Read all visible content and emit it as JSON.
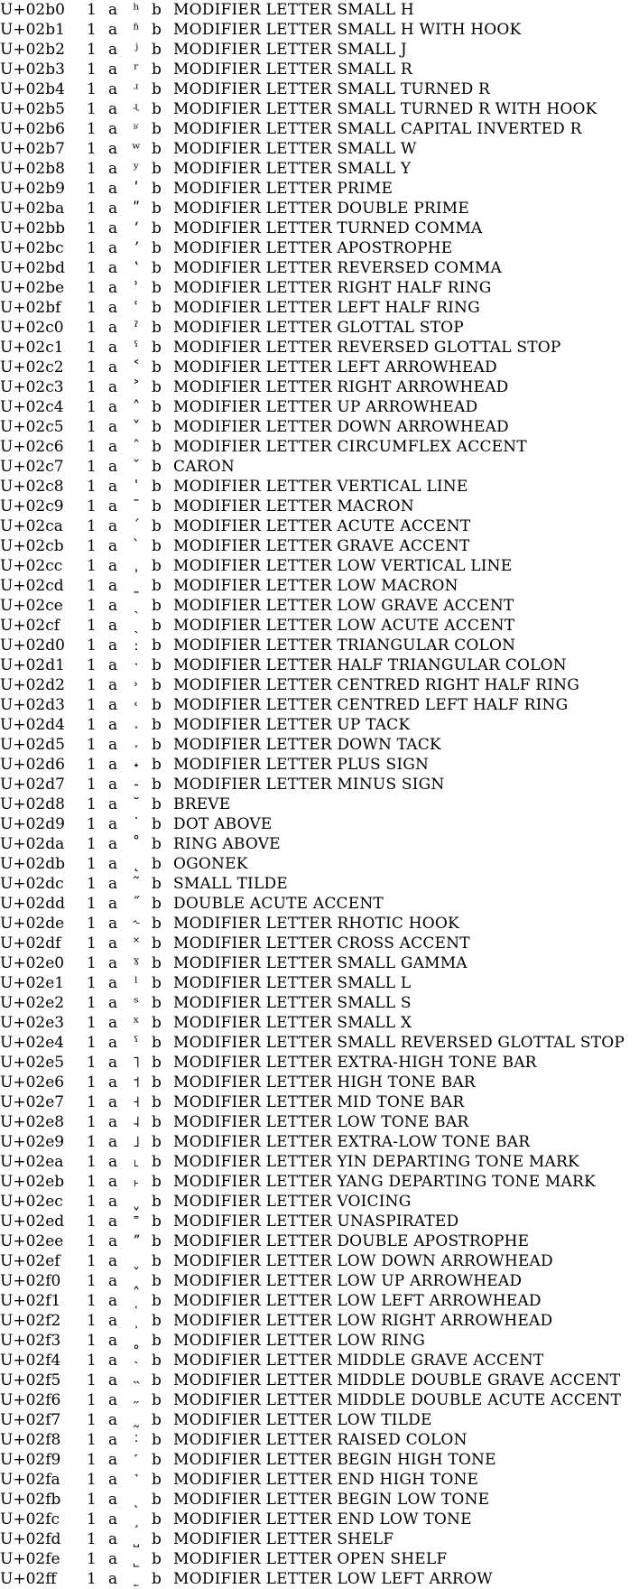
{
  "rows": [
    {
      "code": "U+02b0",
      "n": "1",
      "a": "a",
      "glyph": "ʰ",
      "b": "b",
      "name": "MODIFIER LETTER SMALL H"
    },
    {
      "code": "U+02b1",
      "n": "1",
      "a": "a",
      "glyph": "ʱ",
      "b": "b",
      "name": "MODIFIER LETTER SMALL H WITH HOOK"
    },
    {
      "code": "U+02b2",
      "n": "1",
      "a": "a",
      "glyph": "ʲ",
      "b": "b",
      "name": "MODIFIER LETTER SMALL J"
    },
    {
      "code": "U+02b3",
      "n": "1",
      "a": "a",
      "glyph": "ʳ",
      "b": "b",
      "name": "MODIFIER LETTER SMALL R"
    },
    {
      "code": "U+02b4",
      "n": "1",
      "a": "a",
      "glyph": "ʴ",
      "b": "b",
      "name": "MODIFIER LETTER SMALL TURNED R"
    },
    {
      "code": "U+02b5",
      "n": "1",
      "a": "a",
      "glyph": "ʵ",
      "b": "b",
      "name": "MODIFIER LETTER SMALL TURNED R WITH HOOK"
    },
    {
      "code": "U+02b6",
      "n": "1",
      "a": "a",
      "glyph": "ʶ",
      "b": "b",
      "name": "MODIFIER LETTER SMALL CAPITAL INVERTED R"
    },
    {
      "code": "U+02b7",
      "n": "1",
      "a": "a",
      "glyph": "ʷ",
      "b": "b",
      "name": "MODIFIER LETTER SMALL W"
    },
    {
      "code": "U+02b8",
      "n": "1",
      "a": "a",
      "glyph": "ʸ",
      "b": "b",
      "name": "MODIFIER LETTER SMALL Y"
    },
    {
      "code": "U+02b9",
      "n": "1",
      "a": "a",
      "glyph": "ʹ",
      "b": "b",
      "name": "MODIFIER LETTER PRIME"
    },
    {
      "code": "U+02ba",
      "n": "1",
      "a": "a",
      "glyph": "ʺ",
      "b": "b",
      "name": "MODIFIER LETTER DOUBLE PRIME"
    },
    {
      "code": "U+02bb",
      "n": "1",
      "a": "a",
      "glyph": "ʻ",
      "b": "b",
      "name": "MODIFIER LETTER TURNED COMMA"
    },
    {
      "code": "U+02bc",
      "n": "1",
      "a": "a",
      "glyph": "ʼ",
      "b": "b",
      "name": "MODIFIER LETTER APOSTROPHE"
    },
    {
      "code": "U+02bd",
      "n": "1",
      "a": "a",
      "glyph": "ʽ",
      "b": "b",
      "name": "MODIFIER LETTER REVERSED COMMA"
    },
    {
      "code": "U+02be",
      "n": "1",
      "a": "a",
      "glyph": "ʾ",
      "b": "b",
      "name": "MODIFIER LETTER RIGHT HALF RING"
    },
    {
      "code": "U+02bf",
      "n": "1",
      "a": "a",
      "glyph": "ʿ",
      "b": "b",
      "name": "MODIFIER LETTER LEFT HALF RING"
    },
    {
      "code": "U+02c0",
      "n": "1",
      "a": "a",
      "glyph": "ˀ",
      "b": "b",
      "name": "MODIFIER LETTER GLOTTAL STOP"
    },
    {
      "code": "U+02c1",
      "n": "1",
      "a": "a",
      "glyph": "ˁ",
      "b": "b",
      "name": "MODIFIER LETTER REVERSED GLOTTAL STOP"
    },
    {
      "code": "U+02c2",
      "n": "1",
      "a": "a",
      "glyph": "˂",
      "b": "b",
      "name": "MODIFIER LETTER LEFT ARROWHEAD"
    },
    {
      "code": "U+02c3",
      "n": "1",
      "a": "a",
      "glyph": "˃",
      "b": "b",
      "name": "MODIFIER LETTER RIGHT ARROWHEAD"
    },
    {
      "code": "U+02c4",
      "n": "1",
      "a": "a",
      "glyph": "˄",
      "b": "b",
      "name": "MODIFIER LETTER UP ARROWHEAD"
    },
    {
      "code": "U+02c5",
      "n": "1",
      "a": "a",
      "glyph": "˅",
      "b": "b",
      "name": "MODIFIER LETTER DOWN ARROWHEAD"
    },
    {
      "code": "U+02c6",
      "n": "1",
      "a": "a",
      "glyph": "ˆ",
      "b": "b",
      "name": "MODIFIER LETTER CIRCUMFLEX ACCENT"
    },
    {
      "code": "U+02c7",
      "n": "1",
      "a": "a",
      "glyph": "ˇ",
      "b": "b",
      "name": "CARON"
    },
    {
      "code": "U+02c8",
      "n": "1",
      "a": "a",
      "glyph": "ˈ",
      "b": "b",
      "name": "MODIFIER LETTER VERTICAL LINE"
    },
    {
      "code": "U+02c9",
      "n": "1",
      "a": "a",
      "glyph": "ˉ",
      "b": "b",
      "name": "MODIFIER LETTER MACRON"
    },
    {
      "code": "U+02ca",
      "n": "1",
      "a": "a",
      "glyph": "ˊ",
      "b": "b",
      "name": "MODIFIER LETTER ACUTE ACCENT"
    },
    {
      "code": "U+02cb",
      "n": "1",
      "a": "a",
      "glyph": "ˋ",
      "b": "b",
      "name": "MODIFIER LETTER GRAVE ACCENT"
    },
    {
      "code": "U+02cc",
      "n": "1",
      "a": "a",
      "glyph": "ˌ",
      "b": "b",
      "name": "MODIFIER LETTER LOW VERTICAL LINE"
    },
    {
      "code": "U+02cd",
      "n": "1",
      "a": "a",
      "glyph": "ˍ",
      "b": "b",
      "name": "MODIFIER LETTER LOW MACRON"
    },
    {
      "code": "U+02ce",
      "n": "1",
      "a": "a",
      "glyph": "ˎ",
      "b": "b",
      "name": "MODIFIER LETTER LOW GRAVE ACCENT"
    },
    {
      "code": "U+02cf",
      "n": "1",
      "a": "a",
      "glyph": "ˏ",
      "b": "b",
      "name": "MODIFIER LETTER LOW ACUTE ACCENT"
    },
    {
      "code": "U+02d0",
      "n": "1",
      "a": "a",
      "glyph": "ː",
      "b": "b",
      "name": "MODIFIER LETTER TRIANGULAR COLON"
    },
    {
      "code": "U+02d1",
      "n": "1",
      "a": "a",
      "glyph": "ˑ",
      "b": "b",
      "name": "MODIFIER LETTER HALF TRIANGULAR COLON"
    },
    {
      "code": "U+02d2",
      "n": "1",
      "a": "a",
      "glyph": "˒",
      "b": "b",
      "name": "MODIFIER LETTER CENTRED RIGHT HALF RING"
    },
    {
      "code": "U+02d3",
      "n": "1",
      "a": "a",
      "glyph": "˓",
      "b": "b",
      "name": "MODIFIER LETTER CENTRED LEFT HALF RING"
    },
    {
      "code": "U+02d4",
      "n": "1",
      "a": "a",
      "glyph": "˔",
      "b": "b",
      "name": "MODIFIER LETTER UP TACK"
    },
    {
      "code": "U+02d5",
      "n": "1",
      "a": "a",
      "glyph": "˕",
      "b": "b",
      "name": "MODIFIER LETTER DOWN TACK"
    },
    {
      "code": "U+02d6",
      "n": "1",
      "a": "a",
      "glyph": "˖",
      "b": "b",
      "name": "MODIFIER LETTER PLUS SIGN"
    },
    {
      "code": "U+02d7",
      "n": "1",
      "a": "a",
      "glyph": "˗",
      "b": "b",
      "name": "MODIFIER LETTER MINUS SIGN"
    },
    {
      "code": "U+02d8",
      "n": "1",
      "a": "a",
      "glyph": "˘",
      "b": "b",
      "name": "BREVE"
    },
    {
      "code": "U+02d9",
      "n": "1",
      "a": "a",
      "glyph": "˙",
      "b": "b",
      "name": "DOT ABOVE"
    },
    {
      "code": "U+02da",
      "n": "1",
      "a": "a",
      "glyph": "˚",
      "b": "b",
      "name": "RING ABOVE"
    },
    {
      "code": "U+02db",
      "n": "1",
      "a": "a",
      "glyph": "˛",
      "b": "b",
      "name": "OGONEK"
    },
    {
      "code": "U+02dc",
      "n": "1",
      "a": "a",
      "glyph": "˜",
      "b": "b",
      "name": "SMALL TILDE"
    },
    {
      "code": "U+02dd",
      "n": "1",
      "a": "a",
      "glyph": "˝",
      "b": "b",
      "name": "DOUBLE ACUTE ACCENT"
    },
    {
      "code": "U+02de",
      "n": "1",
      "a": "a",
      "glyph": "˞",
      "b": "b",
      "name": "MODIFIER LETTER RHOTIC HOOK"
    },
    {
      "code": "U+02df",
      "n": "1",
      "a": "a",
      "glyph": "˟",
      "b": "b",
      "name": "MODIFIER LETTER CROSS ACCENT"
    },
    {
      "code": "U+02e0",
      "n": "1",
      "a": "a",
      "glyph": "ˠ",
      "b": "b",
      "name": "MODIFIER LETTER SMALL GAMMA"
    },
    {
      "code": "U+02e1",
      "n": "1",
      "a": "a",
      "glyph": "ˡ",
      "b": "b",
      "name": "MODIFIER LETTER SMALL L"
    },
    {
      "code": "U+02e2",
      "n": "1",
      "a": "a",
      "glyph": "ˢ",
      "b": "b",
      "name": "MODIFIER LETTER SMALL S"
    },
    {
      "code": "U+02e3",
      "n": "1",
      "a": "a",
      "glyph": "ˣ",
      "b": "b",
      "name": "MODIFIER LETTER SMALL X"
    },
    {
      "code": "U+02e4",
      "n": "1",
      "a": "a",
      "glyph": "ˤ",
      "b": "b",
      "name": "MODIFIER LETTER SMALL REVERSED GLOTTAL STOP"
    },
    {
      "code": "U+02e5",
      "n": "1",
      "a": "a",
      "glyph": "˥",
      "b": "b",
      "name": "MODIFIER LETTER EXTRA-HIGH TONE BAR"
    },
    {
      "code": "U+02e6",
      "n": "1",
      "a": "a",
      "glyph": "˦",
      "b": "b",
      "name": "MODIFIER LETTER HIGH TONE BAR"
    },
    {
      "code": "U+02e7",
      "n": "1",
      "a": "a",
      "glyph": "˧",
      "b": "b",
      "name": "MODIFIER LETTER MID TONE BAR"
    },
    {
      "code": "U+02e8",
      "n": "1",
      "a": "a",
      "glyph": "˨",
      "b": "b",
      "name": "MODIFIER LETTER LOW TONE BAR"
    },
    {
      "code": "U+02e9",
      "n": "1",
      "a": "a",
      "glyph": "˩",
      "b": "b",
      "name": "MODIFIER LETTER EXTRA-LOW TONE BAR"
    },
    {
      "code": "U+02ea",
      "n": "1",
      "a": "a",
      "glyph": "˪",
      "b": "b",
      "name": "MODIFIER LETTER YIN DEPARTING TONE MARK"
    },
    {
      "code": "U+02eb",
      "n": "1",
      "a": "a",
      "glyph": "˫",
      "b": "b",
      "name": "MODIFIER LETTER YANG DEPARTING TONE MARK"
    },
    {
      "code": "U+02ec",
      "n": "1",
      "a": "a",
      "glyph": "ˬ",
      "b": "b",
      "name": "MODIFIER LETTER VOICING"
    },
    {
      "code": "U+02ed",
      "n": "1",
      "a": "a",
      "glyph": "˭",
      "b": "b",
      "name": "MODIFIER LETTER UNASPIRATED"
    },
    {
      "code": "U+02ee",
      "n": "1",
      "a": "a",
      "glyph": "ˮ",
      "b": "b",
      "name": "MODIFIER LETTER DOUBLE APOSTROPHE"
    },
    {
      "code": "U+02ef",
      "n": "1",
      "a": "a",
      "glyph": "˯",
      "b": "b",
      "name": "MODIFIER LETTER LOW DOWN ARROWHEAD"
    },
    {
      "code": "U+02f0",
      "n": "1",
      "a": "a",
      "glyph": "˰",
      "b": "b",
      "name": "MODIFIER LETTER LOW UP ARROWHEAD"
    },
    {
      "code": "U+02f1",
      "n": "1",
      "a": "a",
      "glyph": "˱",
      "b": "b",
      "name": "MODIFIER LETTER LOW LEFT ARROWHEAD"
    },
    {
      "code": "U+02f2",
      "n": "1",
      "a": "a",
      "glyph": "˲",
      "b": "b",
      "name": "MODIFIER LETTER LOW RIGHT ARROWHEAD"
    },
    {
      "code": "U+02f3",
      "n": "1",
      "a": "a",
      "glyph": "˳",
      "b": "b",
      "name": "MODIFIER LETTER LOW RING"
    },
    {
      "code": "U+02f4",
      "n": "1",
      "a": "a",
      "glyph": "˴",
      "b": "b",
      "name": "MODIFIER LETTER MIDDLE GRAVE ACCENT"
    },
    {
      "code": "U+02f5",
      "n": "1",
      "a": "a",
      "glyph": "˵",
      "b": "b",
      "name": "MODIFIER LETTER MIDDLE DOUBLE GRAVE ACCENT"
    },
    {
      "code": "U+02f6",
      "n": "1",
      "a": "a",
      "glyph": "˶",
      "b": "b",
      "name": "MODIFIER LETTER MIDDLE DOUBLE ACUTE ACCENT"
    },
    {
      "code": "U+02f7",
      "n": "1",
      "a": "a",
      "glyph": "˷",
      "b": "b",
      "name": "MODIFIER LETTER LOW TILDE"
    },
    {
      "code": "U+02f8",
      "n": "1",
      "a": "a",
      "glyph": "˸",
      "b": "b",
      "name": "MODIFIER LETTER RAISED COLON"
    },
    {
      "code": "U+02f9",
      "n": "1",
      "a": "a",
      "glyph": "˹",
      "b": "b",
      "name": "MODIFIER LETTER BEGIN HIGH TONE"
    },
    {
      "code": "U+02fa",
      "n": "1",
      "a": "a",
      "glyph": "˺",
      "b": "b",
      "name": "MODIFIER LETTER END HIGH TONE"
    },
    {
      "code": "U+02fb",
      "n": "1",
      "a": "a",
      "glyph": "˻",
      "b": "b",
      "name": "MODIFIER LETTER BEGIN LOW TONE"
    },
    {
      "code": "U+02fc",
      "n": "1",
      "a": "a",
      "glyph": "˼",
      "b": "b",
      "name": "MODIFIER LETTER END LOW TONE"
    },
    {
      "code": "U+02fd",
      "n": "1",
      "a": "a",
      "glyph": "˽",
      "b": "b",
      "name": "MODIFIER LETTER SHELF"
    },
    {
      "code": "U+02fe",
      "n": "1",
      "a": "a",
      "glyph": "˾",
      "b": "b",
      "name": "MODIFIER LETTER OPEN SHELF"
    },
    {
      "code": "U+02ff",
      "n": "1",
      "a": "a",
      "glyph": "˿",
      "b": "b",
      "name": "MODIFIER LETTER LOW LEFT ARROW"
    }
  ]
}
